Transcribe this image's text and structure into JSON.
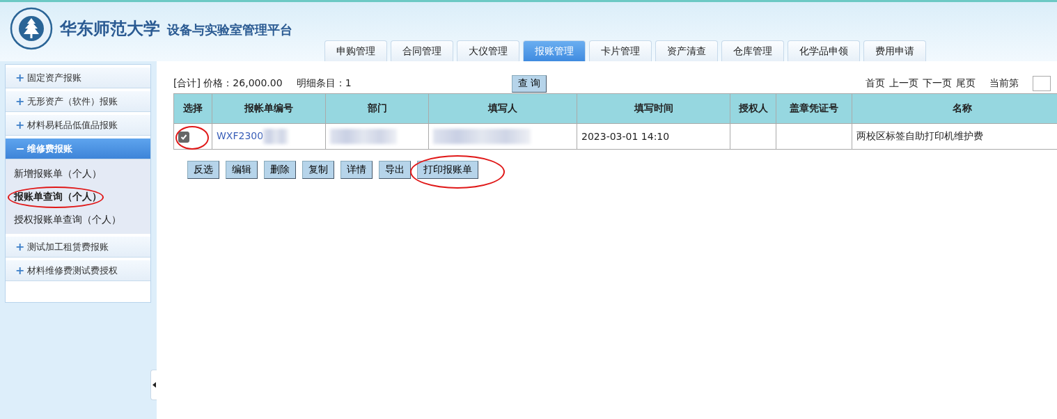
{
  "header": {
    "university": "华东师范大学",
    "platform": "设备与实验室管理平台"
  },
  "tabs": [
    {
      "label": "申购管理",
      "selected": false
    },
    {
      "label": "合同管理",
      "selected": false
    },
    {
      "label": "大仪管理",
      "selected": false
    },
    {
      "label": "报账管理",
      "selected": true
    },
    {
      "label": "卡片管理",
      "selected": false
    },
    {
      "label": "资产清查",
      "selected": false
    },
    {
      "label": "仓库管理",
      "selected": false
    },
    {
      "label": "化学品申领",
      "selected": false
    },
    {
      "label": "费用申请",
      "selected": false
    }
  ],
  "sidebar": {
    "groups": [
      {
        "icon": "+",
        "label": "固定资产报账",
        "expanded": false
      },
      {
        "icon": "+",
        "label": "无形资产（软件）报账",
        "expanded": false
      },
      {
        "icon": "+",
        "label": "材料易耗品低值品报账",
        "expanded": false
      },
      {
        "icon": "−",
        "label": "维修费报账",
        "expanded": true,
        "children": [
          {
            "label": "新增报账单（个人）",
            "selected": false,
            "circled": false
          },
          {
            "label": "报账单查询（个人）",
            "selected": true,
            "circled": true
          },
          {
            "label": "授权报账单查询（个人）",
            "selected": false,
            "circled": false
          }
        ]
      },
      {
        "icon": "+",
        "label": "测试加工租赁费报账",
        "expanded": false
      },
      {
        "icon": "+",
        "label": "材料维修费测试费授权",
        "expanded": false
      }
    ]
  },
  "summary": {
    "total_label": "[合计] 价格：26,000.00",
    "count_label": "明细条目：1"
  },
  "query_button": "查 询",
  "pagination": {
    "links": [
      "首页",
      "上一页",
      "下一页",
      "尾页"
    ],
    "current_label": "当前第"
  },
  "table": {
    "columns": [
      "选择",
      "报帐单编号",
      "部门",
      "填写人",
      "填写时间",
      "授权人",
      "盖章凭证号",
      "名称"
    ],
    "rows": [
      {
        "checked": true,
        "circled": true,
        "number": "WXF2300",
        "time": "2023-03-01 14:10",
        "name": "两校区标签自助打印机维护费"
      }
    ]
  },
  "actions": [
    {
      "label": "反选",
      "circled": false
    },
    {
      "label": "编辑",
      "circled": false
    },
    {
      "label": "删除",
      "circled": false
    },
    {
      "label": "复制",
      "circled": false
    },
    {
      "label": "详情",
      "circled": false
    },
    {
      "label": "导出",
      "circled": false
    },
    {
      "label": "打印报账单",
      "circled": true
    }
  ]
}
